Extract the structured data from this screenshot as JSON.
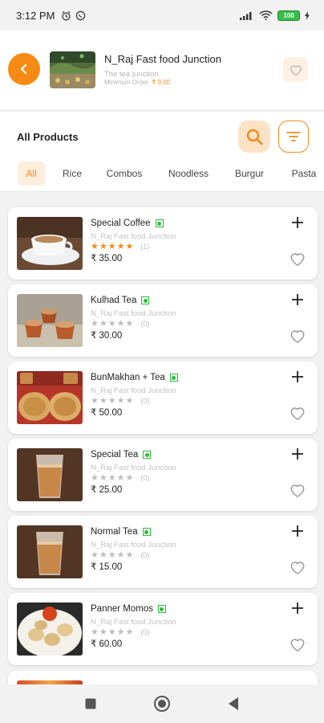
{
  "status_bar": {
    "time": "3:12 PM",
    "battery": "100"
  },
  "store": {
    "name": "N_Raj Fast food Junction",
    "subtitle": "The tea junction",
    "min_order_label": "Minimum Order",
    "min_order_value": "₹ 0.00"
  },
  "products_header": {
    "title": "All Products"
  },
  "tabs": [
    {
      "label": "All",
      "active": true
    },
    {
      "label": "Rice"
    },
    {
      "label": "Combos"
    },
    {
      "label": "Noodless"
    },
    {
      "label": "Burgur"
    },
    {
      "label": "Pasta"
    }
  ],
  "products": [
    {
      "name": "Special Coffee",
      "store": "N_Raj Fast food Junction",
      "rating": 5,
      "reviews": "(1)",
      "price": "₹ 35.00",
      "veg": true
    },
    {
      "name": "Kulhad Tea",
      "store": "N_Raj Fast food Junction",
      "rating": 0,
      "reviews": "(0)",
      "price": "₹ 30.00",
      "veg": true
    },
    {
      "name": "BunMakhan + Tea",
      "store": "N_Raj Fast food Junction",
      "rating": 0,
      "reviews": "(0)",
      "price": "₹ 50.00",
      "veg": true
    },
    {
      "name": "Special Tea",
      "store": "N_Raj Fast food Junction",
      "rating": 0,
      "reviews": "(0)",
      "price": "₹ 25.00",
      "veg": true
    },
    {
      "name": "Normal Tea",
      "store": "N_Raj Fast food Junction",
      "rating": 0,
      "reviews": "(0)",
      "price": "₹ 15.00",
      "veg": true
    },
    {
      "name": "Panner Momos",
      "store": "N_Raj Fast food Junction",
      "rating": 0,
      "reviews": "(0)",
      "price": "₹ 60.00",
      "veg": true
    }
  ],
  "colors": {
    "accent": "#f58a14",
    "veg_green": "#2cbb3e",
    "star_active": "#f58a14",
    "star_inactive": "#bdbdbd"
  }
}
